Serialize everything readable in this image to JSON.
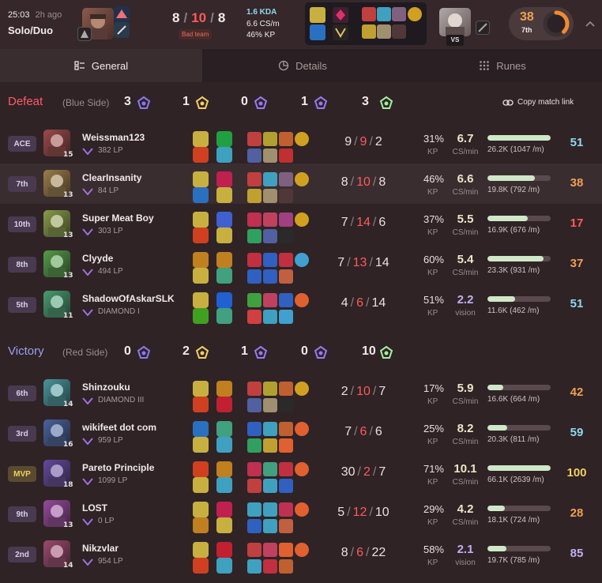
{
  "header": {
    "time": "25:03",
    "ago": "2h ago",
    "queue": "Solo/Duo",
    "kills": "8",
    "deaths": "10",
    "assists": "8",
    "team_note": "Bad team",
    "kda": "1.6 KDA",
    "cs": "6.6 CS/m",
    "kp": "46% KP",
    "vs": "VS",
    "score": "38",
    "rank": "7th",
    "score_fraction": 0.38
  },
  "tabs": [
    {
      "label": "General",
      "icon": "list-icon"
    },
    {
      "label": "Details",
      "icon": "chart-icon"
    },
    {
      "label": "Runes",
      "icon": "grid-icon"
    }
  ],
  "teams": [
    {
      "result": "Defeat",
      "side": "(Blue Side)",
      "barons": "3",
      "dragons": "1",
      "heralds": "0",
      "grubs": "1",
      "towers": "3",
      "copy": "Copy match link",
      "players": [
        {
          "badge": "ACE",
          "name": "Weissman123",
          "rank": "382 LP",
          "level": "15",
          "k": "9",
          "d": "9",
          "a": "2",
          "kp": "31%",
          "cs": "6.7",
          "cs_label": "CS/min",
          "damage": "26.2K (1047 /m)",
          "dmg_frac": 1.0,
          "score": "51",
          "score_color": "#8fd8f0"
        },
        {
          "badge": "7th",
          "name": "ClearInsanity",
          "rank": "84 LP",
          "level": "13",
          "k": "8",
          "d": "10",
          "a": "8",
          "kp": "46%",
          "cs": "6.6",
          "cs_label": "CS/min",
          "damage": "19.8K (792 /m)",
          "dmg_frac": 0.75,
          "score": "38",
          "score_color": "#f0a050"
        },
        {
          "badge": "10th",
          "name": "Super Meat Boy",
          "rank": "303 LP",
          "level": "13",
          "k": "7",
          "d": "14",
          "a": "6",
          "kp": "37%",
          "cs": "5.5",
          "cs_label": "CS/min",
          "damage": "16.9K (676 /m)",
          "dmg_frac": 0.64,
          "score": "17",
          "score_color": "#ff5a5a"
        },
        {
          "badge": "8th",
          "name": "Clyyde",
          "rank": "494 LP",
          "level": "13",
          "k": "7",
          "d": "13",
          "a": "14",
          "kp": "60%",
          "cs": "5.4",
          "cs_label": "CS/min",
          "damage": "23.3K (931 /m)",
          "dmg_frac": 0.89,
          "score": "37",
          "score_color": "#f0a050"
        },
        {
          "badge": "5th",
          "name": "ShadowOfAskarSLK",
          "rank": "DIAMOND I",
          "level": "11",
          "k": "4",
          "d": "6",
          "a": "14",
          "kp": "51%",
          "cs": "2.2",
          "cs_label": "vision",
          "damage": "11.6K (462 /m)",
          "dmg_frac": 0.44,
          "score": "51",
          "score_color": "#8fd8f0"
        }
      ]
    },
    {
      "result": "Victory",
      "side": "(Red Side)",
      "barons": "0",
      "dragons": "2",
      "heralds": "1",
      "grubs": "0",
      "towers": "10",
      "players": [
        {
          "badge": "6th",
          "name": "Shinzouku",
          "rank": "DIAMOND III",
          "level": "14",
          "k": "2",
          "d": "10",
          "a": "7",
          "kp": "17%",
          "cs": "5.9",
          "cs_label": "CS/min",
          "damage": "16.6K (664 /m)",
          "dmg_frac": 0.25,
          "score": "42",
          "score_color": "#f0a050"
        },
        {
          "badge": "3rd",
          "name": "wikifeet dot com",
          "rank": "959 LP",
          "level": "16",
          "k": "7",
          "d": "6",
          "a": "6",
          "kp": "25%",
          "cs": "8.2",
          "cs_label": "CS/min",
          "damage": "20.3K (811 /m)",
          "dmg_frac": 0.31,
          "score": "59",
          "score_color": "#8fd8f0"
        },
        {
          "badge": "MVP",
          "name": "Pareto Principle",
          "rank": "1099 LP",
          "level": "18",
          "k": "30",
          "d": "2",
          "a": "7",
          "kp": "71%",
          "cs": "10.1",
          "cs_label": "CS/min",
          "damage": "66.1K (2639 /m)",
          "dmg_frac": 1.0,
          "score": "100",
          "score_color": "#f0d060"
        },
        {
          "badge": "9th",
          "name": "LOST",
          "rank": "0 LP",
          "level": "13",
          "k": "5",
          "d": "12",
          "a": "10",
          "kp": "29%",
          "cs": "4.2",
          "cs_label": "CS/min",
          "damage": "18.1K (724 /m)",
          "dmg_frac": 0.27,
          "score": "28",
          "score_color": "#f0a050"
        },
        {
          "badge": "2nd",
          "name": "Nikzvlar",
          "rank": "954 LP",
          "level": "14",
          "k": "8",
          "d": "6",
          "a": "22",
          "kp": "58%",
          "cs": "2.1",
          "cs_label": "vision",
          "damage": "19.7K (785 /m)",
          "dmg_frac": 0.3,
          "score": "85",
          "score_color": "#c0b0f0"
        }
      ]
    }
  ],
  "labels": {
    "kp": "KP"
  }
}
